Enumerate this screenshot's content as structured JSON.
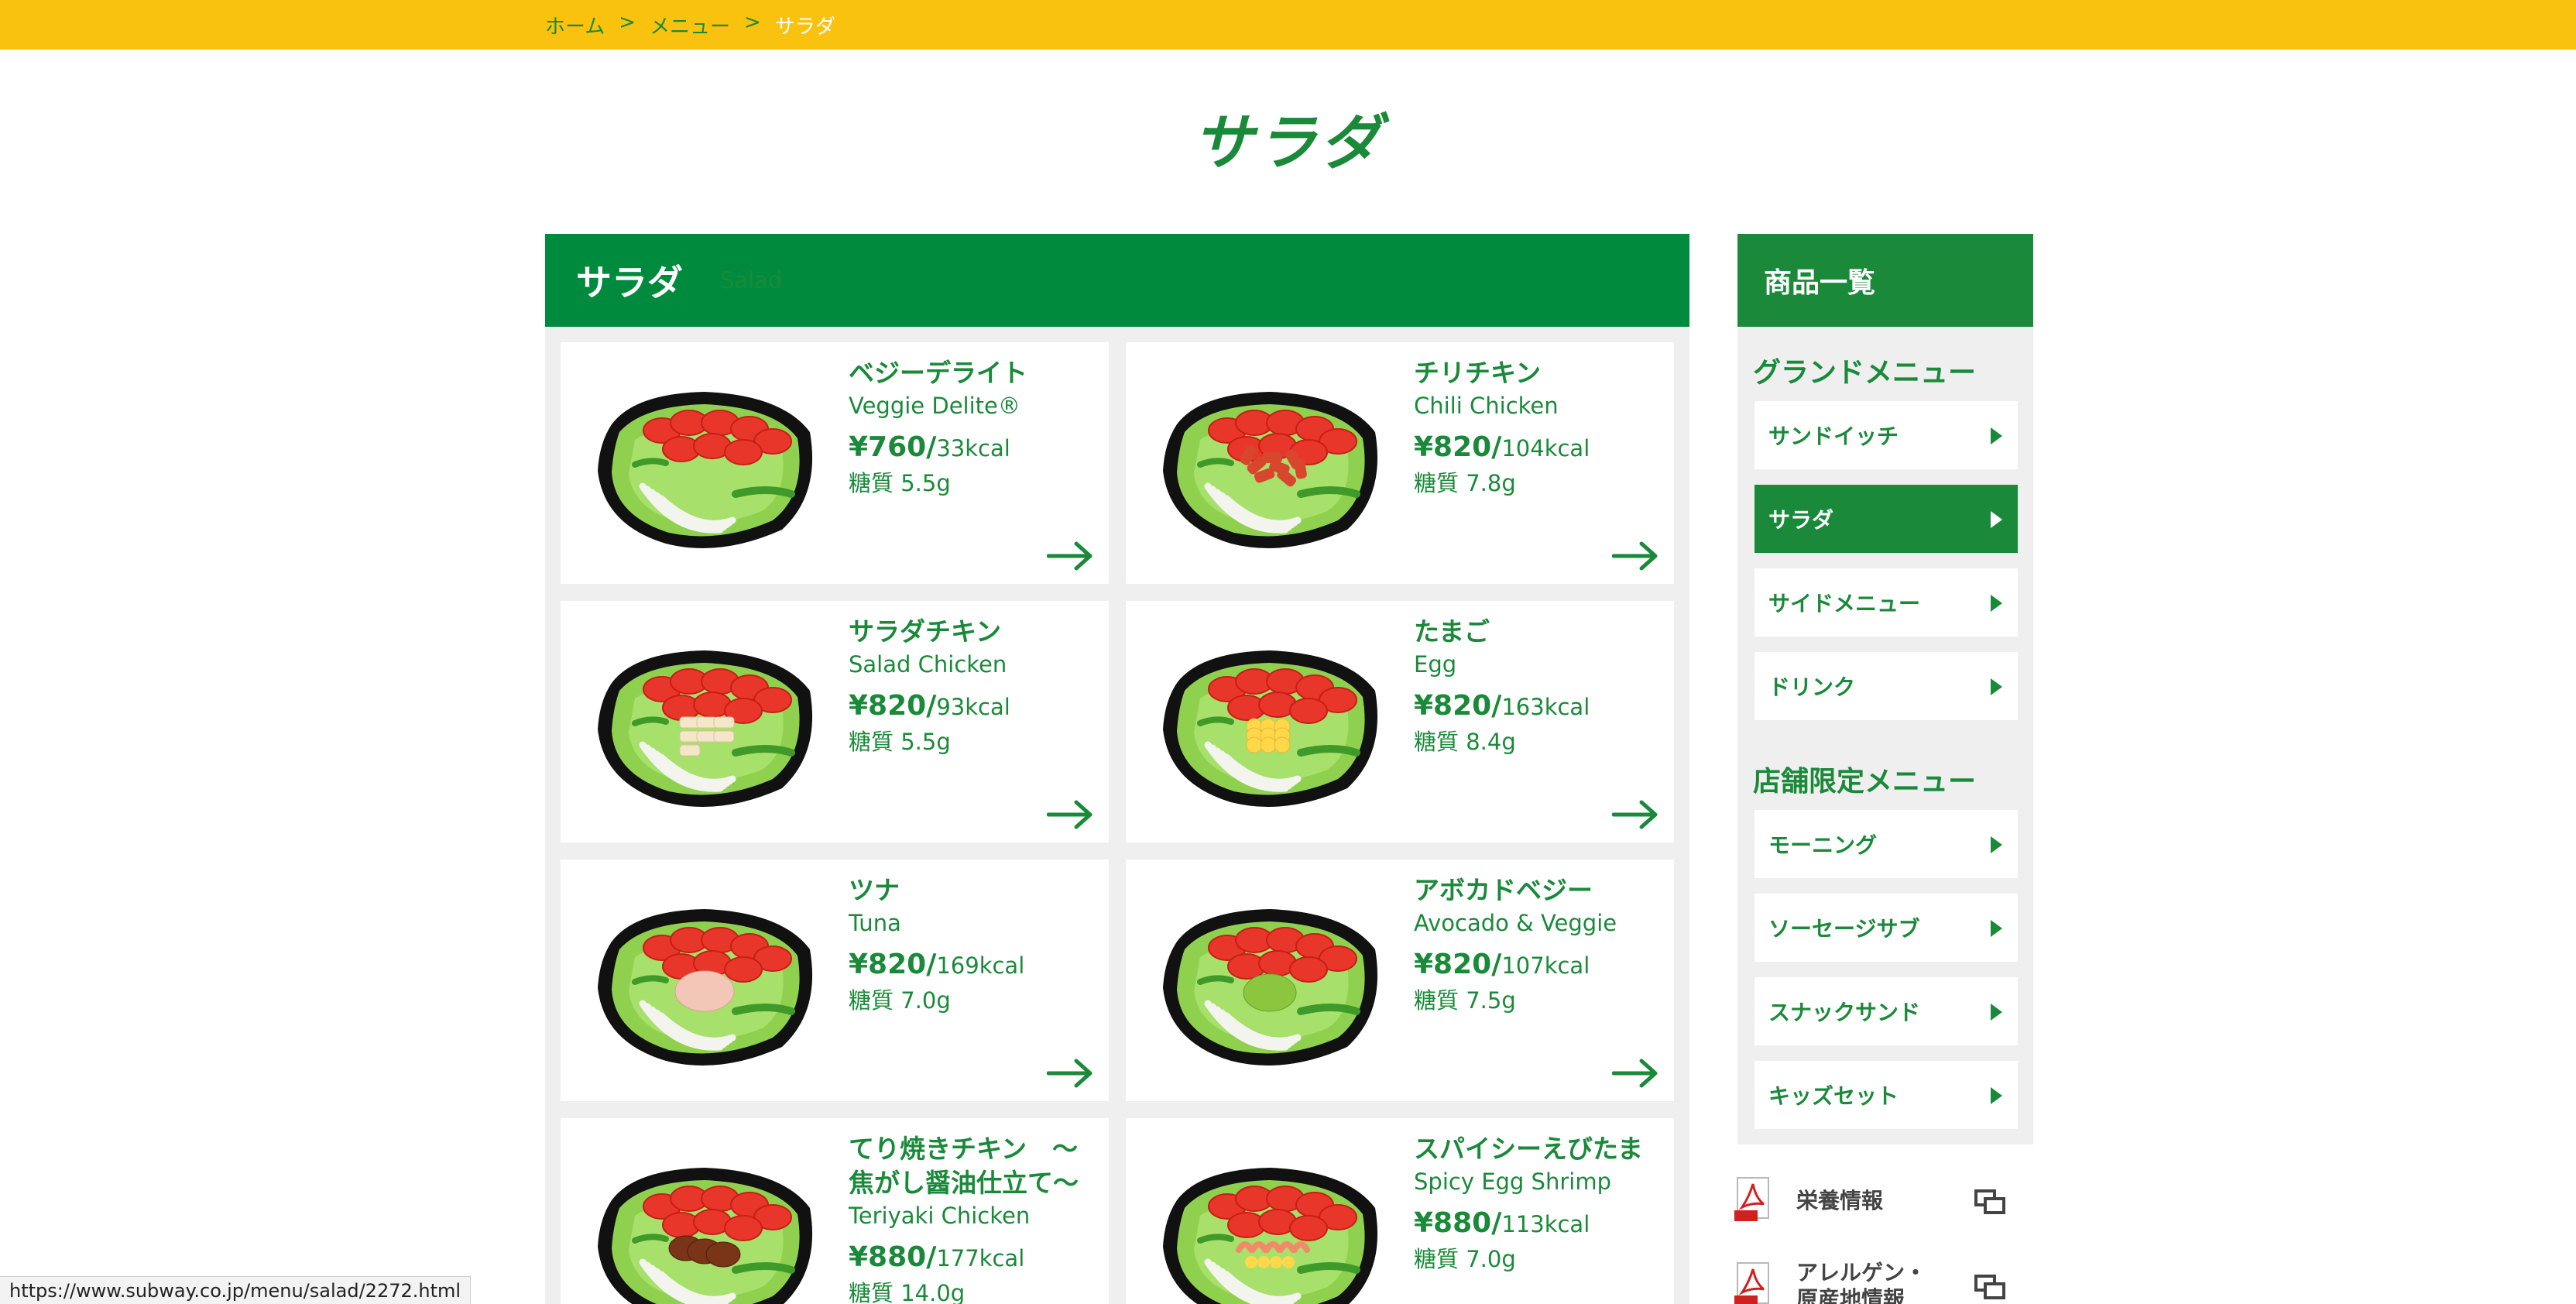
{
  "breadcrumb": {
    "home": "ホーム",
    "menu": "メニュー",
    "current": "サラダ",
    "sep": ">"
  },
  "page_title": "サラダ",
  "section_header": {
    "jp": "サラダ",
    "en": "Salad"
  },
  "products": [
    {
      "jp": "ベジーデライト",
      "en": "Veggie Delite®",
      "price": "¥760/",
      "kcal": "33kcal",
      "sugar": "糖質 5.5g",
      "topping": "none"
    },
    {
      "jp": "チリチキン",
      "en": "Chili Chicken",
      "price": "¥820/",
      "kcal": "104kcal",
      "sugar": "糖質 7.8g",
      "topping": "chili"
    },
    {
      "jp": "サラダチキン",
      "en": "Salad Chicken",
      "price": "¥820/",
      "kcal": "93kcal",
      "sugar": "糖質 5.5g",
      "topping": "chicken"
    },
    {
      "jp": "たまご",
      "en": "Egg",
      "price": "¥820/",
      "kcal": "163kcal",
      "sugar": "糖質 8.4g",
      "topping": "egg"
    },
    {
      "jp": "ツナ",
      "en": "Tuna",
      "price": "¥820/",
      "kcal": "169kcal",
      "sugar": "糖質 7.0g",
      "topping": "tuna"
    },
    {
      "jp": "アボカドベジー",
      "en": "Avocado & Veggie",
      "price": "¥820/",
      "kcal": "107kcal",
      "sugar": "糖質 7.5g",
      "topping": "avocado"
    },
    {
      "jp": "てり焼きチキン　〜",
      "jp2": "焦がし醤油仕立て〜",
      "en": "Teriyaki Chicken",
      "price": "¥880/",
      "kcal": "177kcal",
      "sugar": "糖質 14.0g",
      "topping": "teriyaki"
    },
    {
      "jp": "スパイシーえびたま",
      "en": "Spicy Egg Shrimp",
      "price": "¥880/",
      "kcal": "113kcal",
      "sugar": "糖質 7.0g",
      "topping": "shrimp"
    }
  ],
  "sidebar": {
    "title": "商品一覧",
    "grand_menu_title": "グランドメニュー",
    "grand_menu": [
      "サンドイッチ",
      "サラダ",
      "サイドメニュー",
      "ドリンク"
    ],
    "active_index": 1,
    "store_menu_title": "店舗限定メニュー",
    "store_menu": [
      "モーニング",
      "ソーセージサブ",
      "スナックサンド",
      "キッズセット"
    ]
  },
  "links": {
    "nutrition": "栄養情報",
    "allergen_line1": "アレルゲン・",
    "allergen_line2": "原産地情報"
  },
  "status_url": "https://www.subway.co.jp/menu/salad/2272.html",
  "colors": {
    "brand_green": "#008a3e",
    "text_green": "#1a8a3a",
    "brand_yellow": "#f9c20f"
  }
}
